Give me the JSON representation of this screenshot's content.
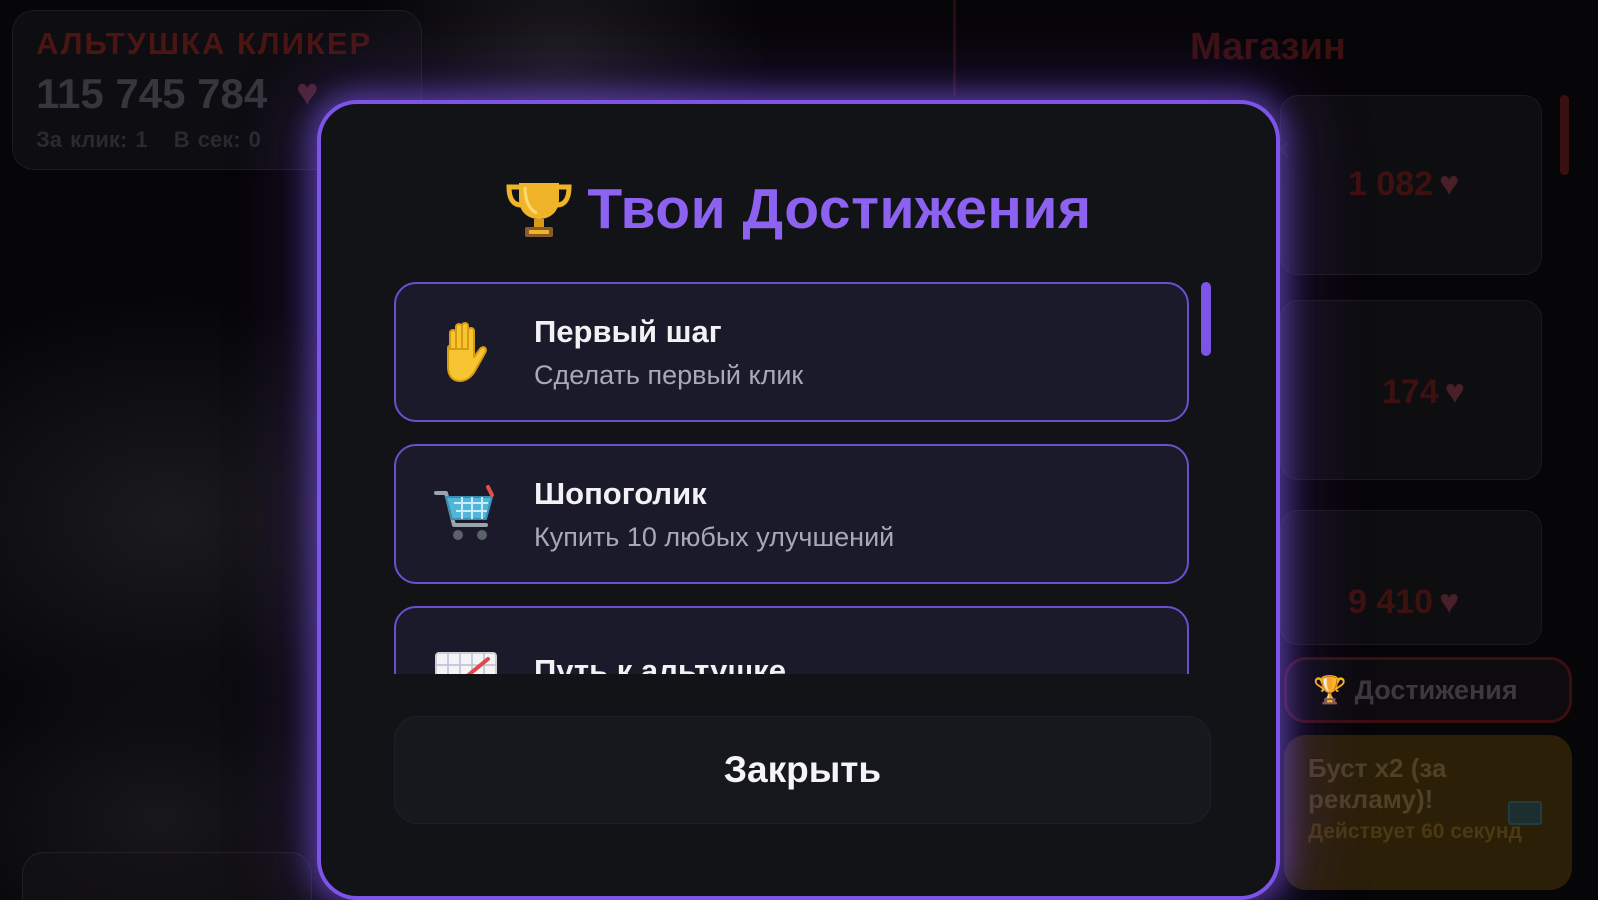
{
  "background": {
    "app_title": "АЛЬТУШКА КЛИКЕР",
    "score": "115 745 784",
    "per_click": "За клик: 1",
    "per_second": "В сек: 0",
    "shop_title": "Магазин",
    "shop_prices": [
      "1 082",
      "174",
      "9 410"
    ],
    "achievements_button_label": "Достижения",
    "boost_label": "Буст x2 (за рекламу)!",
    "boost_sub": "Действует 60 секунд"
  },
  "modal": {
    "title": "Твои Достижения",
    "title_color": "#8d62f0",
    "border_color": "#7c55e8",
    "achievements": [
      {
        "icon": "raised-hand-icon",
        "title": "Первый шаг",
        "description": "Сделать первый клик"
      },
      {
        "icon": "shopping-cart-icon",
        "title": "Шопоголик",
        "description": "Купить 10 любых улучшений"
      },
      {
        "icon": "chart-icon",
        "title": "Путь к альтушке",
        "description": ""
      }
    ],
    "close_label": "Закрыть"
  }
}
